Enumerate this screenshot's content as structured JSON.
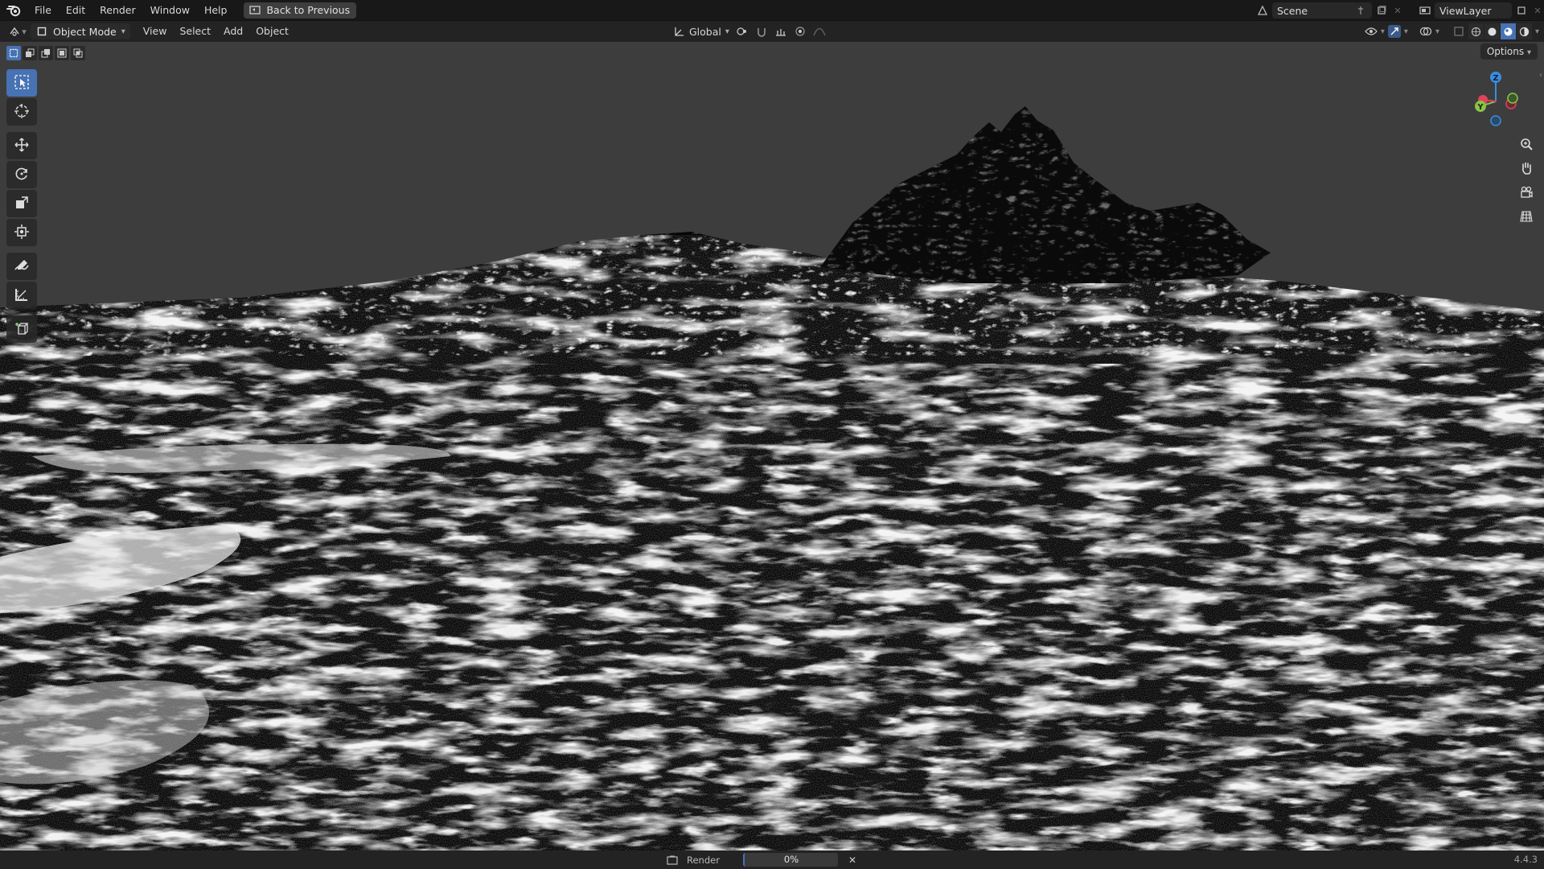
{
  "topbar": {
    "menus": [
      "File",
      "Edit",
      "Render",
      "Window",
      "Help"
    ],
    "back_label": "Back to Previous",
    "scene_name": "Scene",
    "view_layer": "ViewLayer"
  },
  "header": {
    "mode": "Object Mode",
    "menus": [
      "View",
      "Select",
      "Add",
      "Object"
    ],
    "transform_orientation": "Global"
  },
  "viewport": {
    "options_label": "Options",
    "gizmo_axes": {
      "z": "Z",
      "y": "Y"
    },
    "tools": [
      "select-box-icon",
      "cursor-icon",
      "move-icon",
      "rotate-icon",
      "scale-icon",
      "transform-icon",
      "annotate-icon",
      "measure-icon",
      "add-cube-icon"
    ],
    "nav_buttons": [
      "zoom-icon",
      "pan-hand-icon",
      "camera-icon",
      "grid-icon"
    ]
  },
  "status": {
    "render_label": "Render",
    "progress_text": "0%",
    "progress_value": 0,
    "version": "4.4.3"
  },
  "colors": {
    "accent": "#4772b3",
    "axis_x": "#e0435c",
    "axis_y": "#8bc34a",
    "axis_z": "#3a8de0"
  }
}
